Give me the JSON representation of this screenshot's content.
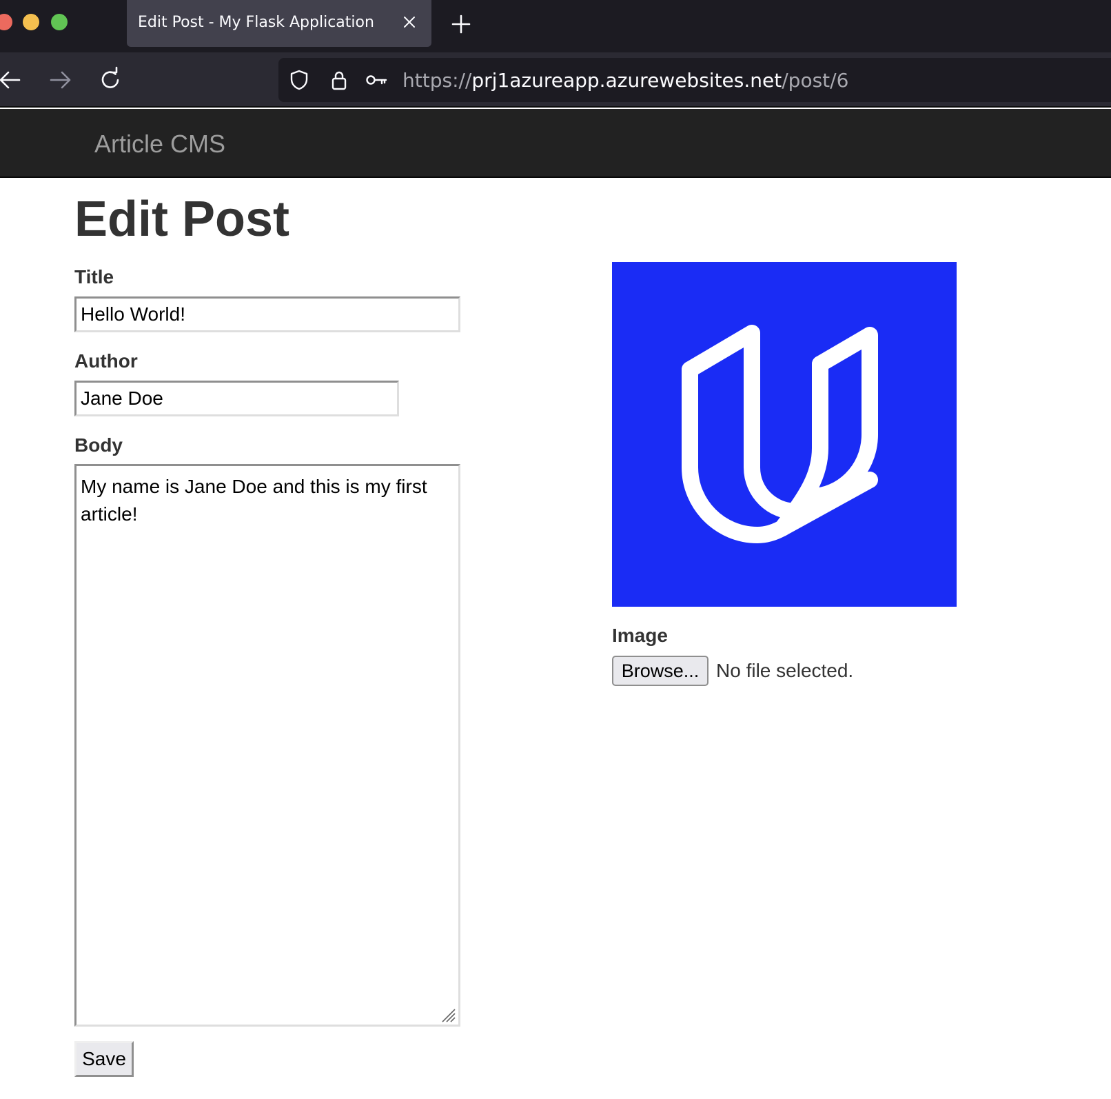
{
  "browser": {
    "tab_title": "Edit Post - My Flask Application",
    "url_scheme": "https://",
    "url_host": "prj1azureapp.azurewebsites.net",
    "url_path": "/post/6"
  },
  "site": {
    "brand": "Article CMS"
  },
  "form": {
    "heading": "Edit Post",
    "title_label": "Title",
    "title_value": "Hello World!",
    "author_label": "Author",
    "author_value": "Jane Doe",
    "body_label": "Body",
    "body_value": "My name is Jane Doe and this is my first article!",
    "image_label": "Image",
    "browse_label": "Browse...",
    "file_status": "No file selected.",
    "save_label": "Save"
  },
  "colors": {
    "logo_background": "#1a2cf5",
    "site_nav": "#222222",
    "brand_text": "#9d9d9d"
  }
}
